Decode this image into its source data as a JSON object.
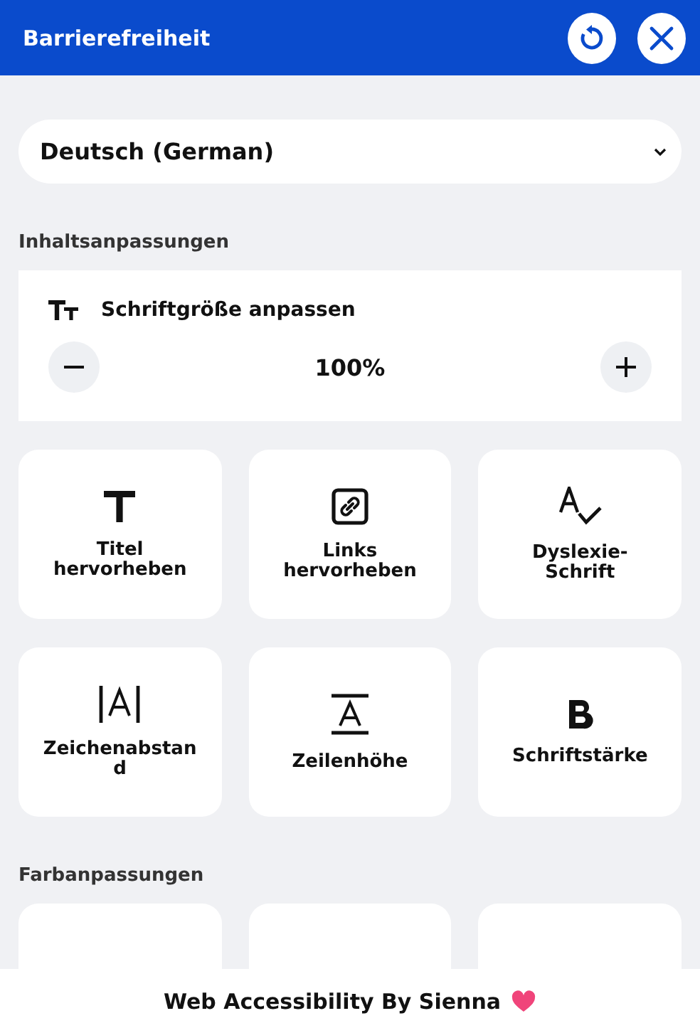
{
  "header": {
    "title": "Barrierefreiheit"
  },
  "language": {
    "value": "Deutsch (German)"
  },
  "sections": [
    {
      "title": "Inhaltsanpassungen",
      "font_size": {
        "label": "Schriftgröße anpassen",
        "value": "100%"
      },
      "tiles": [
        {
          "label": "Titel hervorheben",
          "kind": "title"
        },
        {
          "label": "Links hervorheben",
          "kind": "link"
        },
        {
          "label": "Dyslexie-Schrift",
          "kind": "dyslexia"
        },
        {
          "label": "Zeichenabstand",
          "kind": "spacing"
        },
        {
          "label": "Zeilenhöhe",
          "kind": "lineheight"
        },
        {
          "label": "Schriftstärke",
          "kind": "bold"
        }
      ]
    },
    {
      "title": "Farbanpassungen",
      "tiles": [
        {
          "kind": "cut"
        },
        {
          "kind": "cut"
        },
        {
          "kind": "cut"
        }
      ]
    }
  ],
  "footer": {
    "text": "Web Accessibility By Sienna"
  }
}
